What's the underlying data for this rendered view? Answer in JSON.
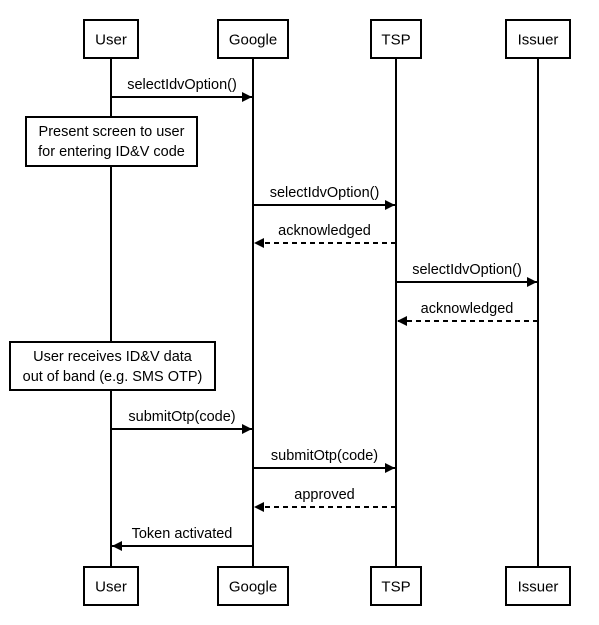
{
  "diagram": {
    "type": "sequence",
    "participants": [
      {
        "id": "user",
        "label": "User"
      },
      {
        "id": "google",
        "label": "Google"
      },
      {
        "id": "tsp",
        "label": "TSP"
      },
      {
        "id": "issuer",
        "label": "Issuer"
      }
    ],
    "steps": [
      {
        "kind": "message",
        "from": "user",
        "to": "google",
        "label": "selectIdvOption()",
        "style": "solid"
      },
      {
        "kind": "note",
        "over": "user",
        "lines": [
          "Present screen to user",
          "for entering ID&V code"
        ]
      },
      {
        "kind": "message",
        "from": "google",
        "to": "tsp",
        "label": "selectIdvOption()",
        "style": "solid"
      },
      {
        "kind": "message",
        "from": "tsp",
        "to": "google",
        "label": "acknowledged",
        "style": "dashed"
      },
      {
        "kind": "message",
        "from": "tsp",
        "to": "issuer",
        "label": "selectIdvOption()",
        "style": "solid"
      },
      {
        "kind": "message",
        "from": "issuer",
        "to": "tsp",
        "label": "acknowledged",
        "style": "dashed"
      },
      {
        "kind": "note",
        "over": "user",
        "lines": [
          "User receives ID&V data",
          "out of band (e.g. SMS OTP)"
        ]
      },
      {
        "kind": "message",
        "from": "user",
        "to": "google",
        "label": "submitOtp(code)",
        "style": "solid"
      },
      {
        "kind": "message",
        "from": "google",
        "to": "tsp",
        "label": "submitOtp(code)",
        "style": "solid"
      },
      {
        "kind": "message",
        "from": "tsp",
        "to": "google",
        "label": "approved",
        "style": "dashed"
      },
      {
        "kind": "message",
        "from": "google",
        "to": "user",
        "label": "Token activated",
        "style": "solid"
      }
    ]
  }
}
